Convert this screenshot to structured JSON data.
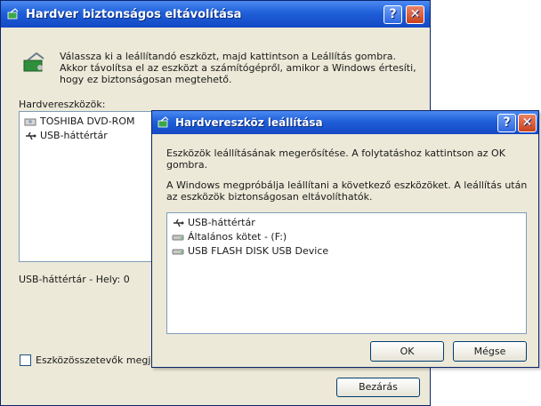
{
  "main_window": {
    "title": "Hardver biztonságos eltávolítása",
    "instruction": [
      "Válassza ki a leállítandó eszközt, majd kattintson a Leállítás gombra.",
      "Akkor távolítsa el az eszközt a számítógépről, amikor a Windows értesíti,",
      "hogy ez biztonságosan megtehető."
    ],
    "devices_label": "Hardvereszközök:",
    "devices": [
      "TOSHIBA DVD-ROM",
      "USB-háttértár"
    ],
    "status": "USB-háttértár - Hely: 0",
    "checkbox_label": "Eszközösszetevők megj",
    "close_button": "Bezárás"
  },
  "dialog": {
    "title": "Hardvereszköz leállítása",
    "confirm_text": [
      "Eszközök leállításának megerősítése. A folytatáshoz kattintson az OK",
      "gombra."
    ],
    "info_text": [
      "A Windows megpróbálja leállítani a következő eszközöket. A leállítás után",
      "az eszközök biztonságosan eltávolíthatók."
    ],
    "devices": [
      "USB-háttértár",
      "Általános kötet - (F:)",
      "USB FLASH DISK USB Device"
    ],
    "ok_button": "OK",
    "cancel_button": "Mégse"
  },
  "icons": [
    "hardware-icon",
    "cd-drive-icon",
    "usb-icon",
    "drive-icon",
    "help-icon",
    "close-icon"
  ],
  "colors": {
    "titlebar": "#1f5fd8",
    "close": "#c9411c",
    "face": "#ece9d8",
    "list_border": "#7f9db9"
  }
}
